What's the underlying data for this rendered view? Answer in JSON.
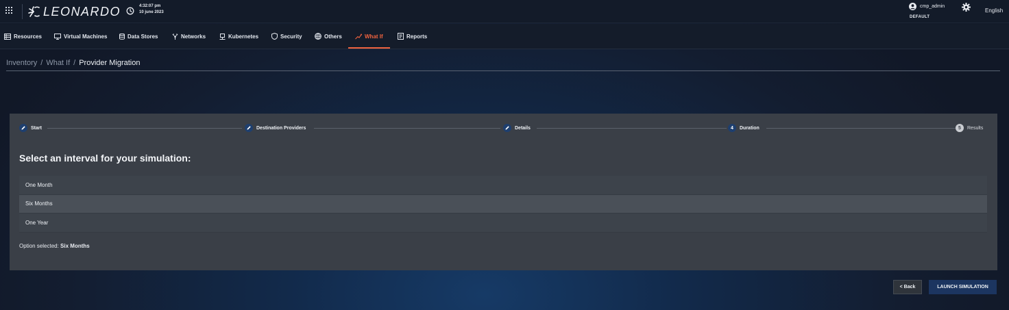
{
  "header": {
    "logo_text": "LEONARDO",
    "time": "4:32:07 pm",
    "date": "10 june 2023",
    "username": "cmp_admin",
    "tenant": "DEFAULT",
    "language": "English"
  },
  "nav": {
    "items": [
      {
        "label": "Resources",
        "icon": "server-icon"
      },
      {
        "label": "Virtual Machines",
        "icon": "monitor-icon"
      },
      {
        "label": "Data Stores",
        "icon": "database-icon"
      },
      {
        "label": "Networks",
        "icon": "network-icon"
      },
      {
        "label": "Kubernetes",
        "icon": "kubernetes-icon"
      },
      {
        "label": "Security",
        "icon": "shield-icon"
      },
      {
        "label": "Others",
        "icon": "globe-icon"
      },
      {
        "label": "What If",
        "icon": "what-if-icon",
        "active": true
      },
      {
        "label": "Reports",
        "icon": "report-icon"
      }
    ]
  },
  "breadcrumb": {
    "items": [
      "Inventory",
      "What If",
      "Provider Migration"
    ],
    "separator": "/"
  },
  "stepper": {
    "steps": [
      {
        "label": "Start",
        "status": "done",
        "icon": "pencil-icon"
      },
      {
        "label": "Destination Providers",
        "status": "done",
        "icon": "pencil-icon"
      },
      {
        "label": "Details",
        "status": "done",
        "icon": "pencil-icon"
      },
      {
        "label": "Duration",
        "status": "active",
        "number": "4"
      },
      {
        "label": "Results",
        "status": "pending",
        "number": "5"
      }
    ]
  },
  "duration": {
    "prompt": "Select an interval for your simulation:",
    "options": [
      "One Month",
      "Six Months",
      "One Year"
    ],
    "selected_index": 1,
    "selected_prefix": "Option selected:",
    "selected_value": "Six Months"
  },
  "actions": {
    "back_label": "< Back",
    "launch_label": "LAUNCH SIMULATION"
  },
  "colors": {
    "accent": "#f0633f",
    "primary": "#1c3560",
    "card": "#3a3f47"
  }
}
